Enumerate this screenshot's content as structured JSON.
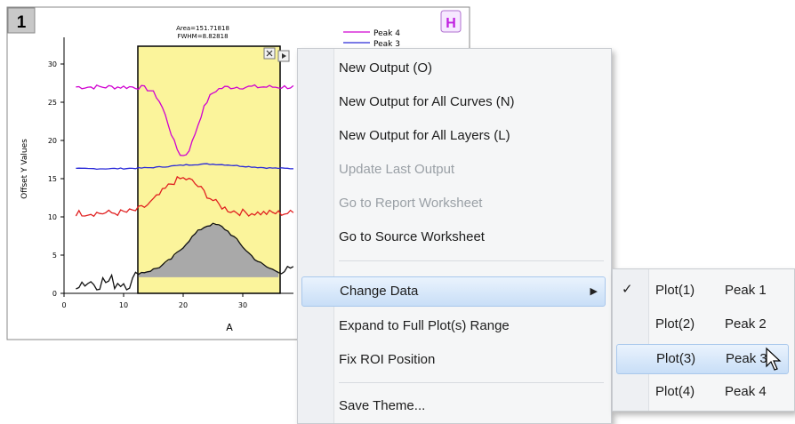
{
  "graph": {
    "layer_number": "1",
    "h_button": "H",
    "roi_label_area": "Area=151.71818",
    "roi_label_fwhm": "FWHM=8.82818",
    "ylabel": "Offset Y Values",
    "xlabel": "A",
    "x_ticks": [
      "0",
      "10",
      "20",
      "30"
    ],
    "y_ticks": [
      "0",
      "5",
      "10",
      "15",
      "20",
      "25",
      "30"
    ],
    "legend": [
      {
        "name": "Peak 4",
        "color": "#d000d0"
      },
      {
        "name": "Peak 3",
        "color": "#2a2ad8"
      }
    ],
    "colors": {
      "peak4": "#d000d0",
      "peak3": "#2a2ad8",
      "peak2": "#e02020",
      "peak1": "#111111",
      "roi_fill": "#fbf49b",
      "area_fill": "#a9a9a9"
    }
  },
  "context_menu": {
    "items": [
      {
        "label": "New Output (O)",
        "enabled": true
      },
      {
        "label": "New Output for All Curves (N)",
        "enabled": true
      },
      {
        "label": "New Output for All Layers (L)",
        "enabled": true
      },
      {
        "label": "Update Last Output",
        "enabled": false
      },
      {
        "label": "Go to Report Worksheet",
        "enabled": false
      },
      {
        "label": "Go to Source Worksheet",
        "enabled": true
      },
      {
        "label": "Change Data",
        "enabled": true,
        "submenu": true,
        "highlighted": true
      },
      {
        "label": "Expand to Full Plot(s) Range",
        "enabled": true
      },
      {
        "label": "Fix ROI Position",
        "enabled": true
      },
      {
        "label": "Save Theme...",
        "enabled": true
      }
    ]
  },
  "submenu": {
    "items": [
      {
        "plot": "Plot(1)",
        "name": "Peak 1",
        "checked": true
      },
      {
        "plot": "Plot(2)",
        "name": "Peak 2",
        "checked": false
      },
      {
        "plot": "Plot(3)",
        "name": "Peak 3",
        "checked": false,
        "highlighted": true
      },
      {
        "plot": "Plot(4)",
        "name": "Peak 4",
        "checked": false
      }
    ],
    "check_glyph": "✓"
  }
}
